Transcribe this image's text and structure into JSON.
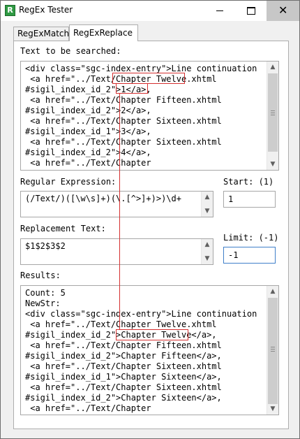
{
  "window": {
    "title": "RegEx Tester",
    "icon_letter": "R",
    "minimize_glyph": "minimize-icon",
    "maximize_glyph": "maximize-icon",
    "close_glyph": "✕"
  },
  "tabs": [
    {
      "label": "RegExMatch",
      "selected": false
    },
    {
      "label": "RegExReplace",
      "selected": true
    }
  ],
  "search": {
    "label": "Text to be searched:",
    "lines": [
      "<div class=\"sgc-index-entry\">Line continuation",
      " <a href=\"../Text/Chapter Twelve.xhtml",
      "#sigil_index_id_2\">1</a>,",
      " <a href=\"../Text/Chapter Fifteen.xhtml",
      "#sigil_index_id_2\">2</a>,",
      " <a href=\"../Text/Chapter Sixteen.xhtml",
      "#sigil_index_id_1\">3</a>,",
      " <a href=\"../Text/Chapter Sixteen.xhtml",
      "#sigil_index_id_2\">4</a>,",
      " <a href=\"../Text/Chapter"
    ]
  },
  "regex": {
    "label": "Regular Expression:",
    "value": "(/Text/)([\\w\\s]+)(\\.[^>]+)>)\\d+"
  },
  "start": {
    "label": "Start: (1)",
    "value": "1"
  },
  "replacement": {
    "label": "Replacement Text:",
    "value": "$1$2$3$2"
  },
  "limit": {
    "label": "Limit: (-1)",
    "value": "-1"
  },
  "results": {
    "label": "Results:",
    "lines": [
      "Count: 5",
      "NewStr:",
      "<div class=\"sgc-index-entry\">Line continuation",
      " <a href=\"../Text/Chapter Twelve.xhtml",
      "#sigil_index_id_2\">Chapter Twelve</a>,",
      " <a href=\"../Text/Chapter Fifteen.xhtml",
      "#sigil_index_id_2\">Chapter Fifteen</a>,",
      " <a href=\"../Text/Chapter Sixteen.xhtml",
      "#sigil_index_id_1\">Chapter Sixteen</a>,",
      " <a href=\"../Text/Chapter Sixteen.xhtml",
      "#sigil_index_id_2\">Chapter Sixteen</a>,",
      " <a href=\"../Text/Chapter"
    ]
  },
  "colors": {
    "annotation": "#d53030",
    "focus_border": "#3f7fc9",
    "close_button_bg": "#c7c7c7"
  }
}
